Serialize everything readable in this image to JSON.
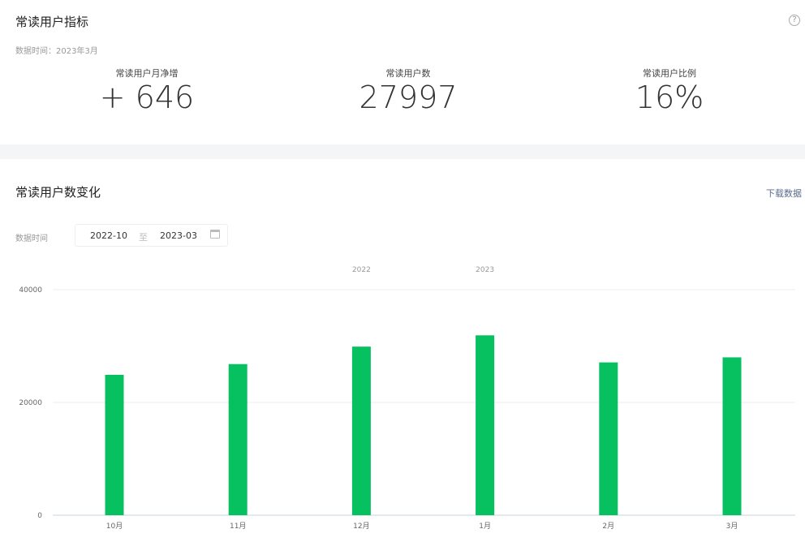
{
  "overview": {
    "title": "常读用户指标",
    "data_time": "数据时间：2023年3月",
    "help_icon": "question-circle-icon",
    "metrics": [
      {
        "label": "常读用户月净增",
        "value": "+ 646"
      },
      {
        "label": "常读用户数",
        "value": "27997"
      },
      {
        "label": "常读用户比例",
        "value": "16%"
      }
    ]
  },
  "trend": {
    "title": "常读用户数变化",
    "download_label": "下载数据",
    "filter_label": "数据时间",
    "range_start": "2022-10",
    "range_sep": "至",
    "range_end": "2023-03",
    "calendar_icon": "calendar-icon"
  },
  "chart_data": {
    "type": "bar",
    "categories": [
      "10月",
      "11月",
      "12月",
      "1月",
      "2月",
      "3月"
    ],
    "year_labels": [
      {
        "label": "2022",
        "at": "12月"
      },
      {
        "label": "2023",
        "at": "1月"
      }
    ],
    "values": [
      24900,
      26800,
      29900,
      31900,
      27100,
      27997
    ],
    "yticks": [
      0,
      20000,
      40000
    ],
    "ylim": [
      0,
      40000
    ],
    "color": "#07c160",
    "grid": true
  }
}
